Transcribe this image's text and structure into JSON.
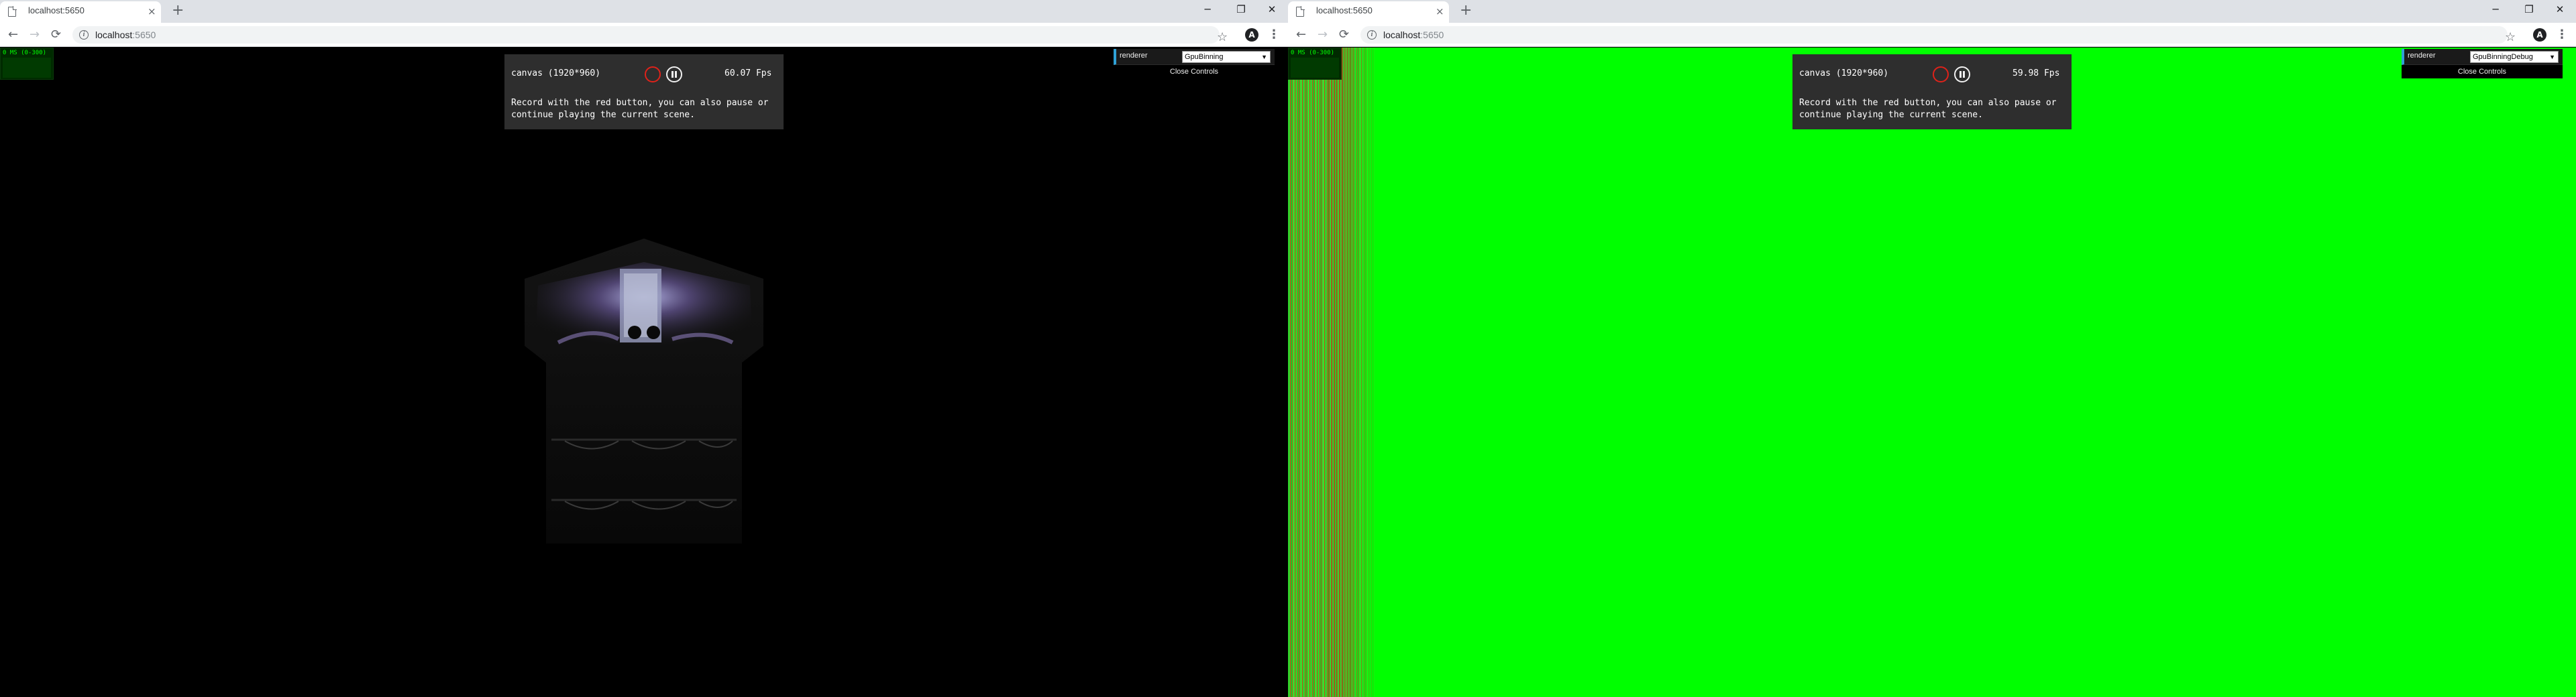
{
  "windows": [
    {
      "tab": {
        "title": "localhost:5650",
        "close": "×"
      },
      "newtab": "+",
      "window_controls": {
        "minimize": "─",
        "restore": "❐",
        "close": "✕"
      },
      "toolbar": {
        "back": "←",
        "forward": "→",
        "reload": "⟳",
        "url_host": "localhost",
        "url_port": ":5650",
        "star": "☆",
        "profile": "A",
        "menu": "⋮"
      },
      "stats": {
        "text": "0 MS (0-300)"
      },
      "panel": {
        "canvas_label": "canvas (1920*960)",
        "fps": "60.07 Fps",
        "description": "Record with the red button, you can also pause or continue playing the current scene."
      },
      "gui": {
        "label": "renderer",
        "selected": "GpuBinning",
        "close": "Close Controls"
      }
    },
    {
      "tab": {
        "title": "localhost:5650",
        "close": "×"
      },
      "newtab": "+",
      "window_controls": {
        "minimize": "─",
        "restore": "❐",
        "close": "✕"
      },
      "toolbar": {
        "back": "←",
        "forward": "→",
        "reload": "⟳",
        "url_host": "localhost",
        "url_port": ":5650",
        "star": "☆",
        "profile": "A",
        "menu": "⋮"
      },
      "stats": {
        "text": "0 MS (0-300)"
      },
      "panel": {
        "canvas_label": "canvas (1920*960)",
        "fps": "59.98 Fps",
        "description": "Record with the red button, you can also pause or continue playing the current scene."
      },
      "gui": {
        "label": "renderer",
        "selected": "GpuBinningDebug",
        "close": "Close Controls"
      }
    }
  ],
  "colors": {
    "debug_green": "#00ff00",
    "record_red": "#e0221a",
    "panel_bg": "#2e2e2e",
    "gui_accent": "#2fa1d6"
  }
}
